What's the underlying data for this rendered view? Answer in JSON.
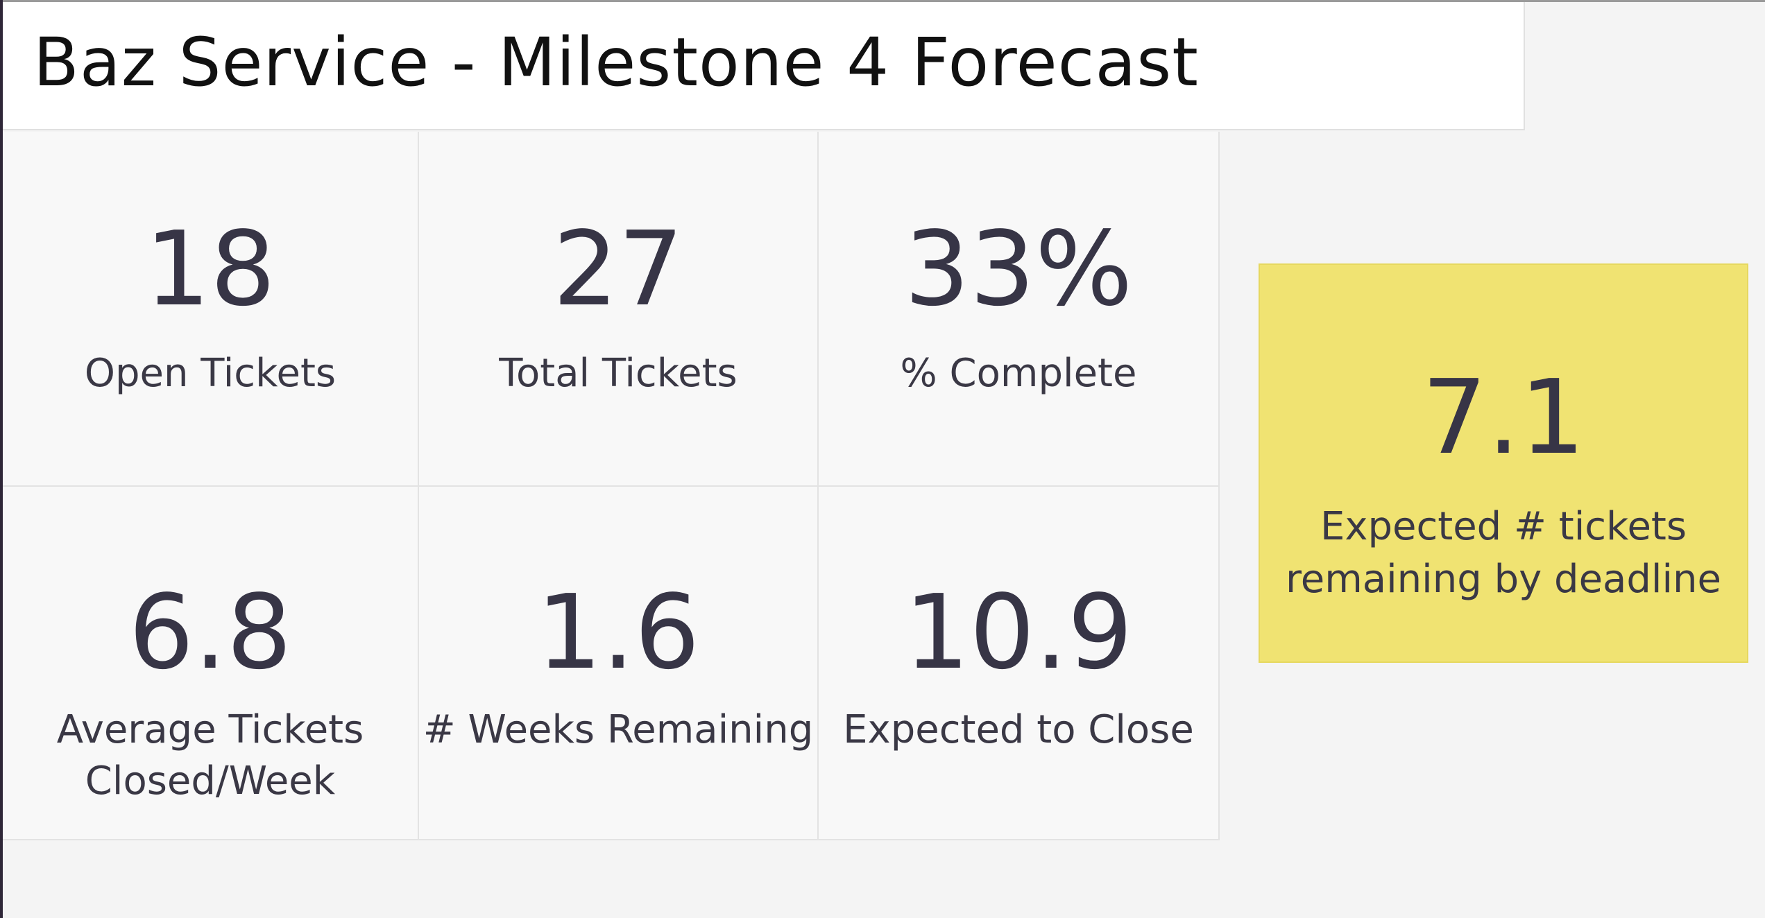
{
  "dashboard": {
    "title": "Baz Service - Milestone 4 Forecast"
  },
  "metrics": [
    {
      "value": "18",
      "label": "Open Tickets"
    },
    {
      "value": "27",
      "label": "Total Tickets"
    },
    {
      "value": "33%",
      "label": "% Complete"
    },
    {
      "value": "6.8",
      "label": "Average Tickets\nClosed/Week"
    },
    {
      "value": "1.6",
      "label": "# Weeks Remaining"
    },
    {
      "value": "10.9",
      "label": "Expected to Close"
    }
  ],
  "highlight": {
    "value": "7.1",
    "label": "Expected # tickets\nremaining by deadline",
    "color": "#f0e372"
  }
}
